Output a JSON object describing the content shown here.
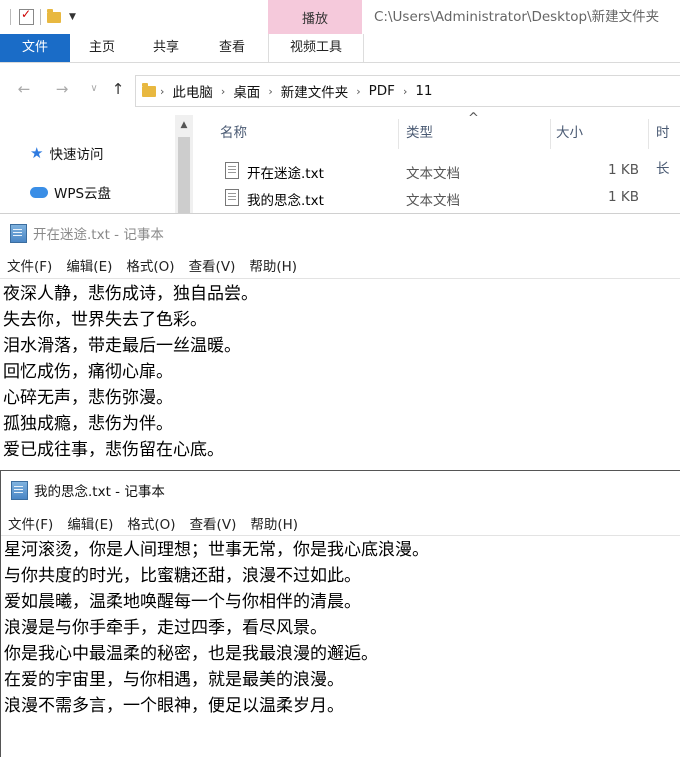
{
  "explorer": {
    "path_title": "C:\\Users\\Administrator\\Desktop\\新建文件夹",
    "contextual_tab": "播放",
    "ribbon_tabs": [
      "文件",
      "主页",
      "共享",
      "查看",
      "视频工具"
    ],
    "breadcrumbs": [
      "此电脑",
      "桌面",
      "新建文件夹",
      "PDF",
      "11"
    ],
    "nav_items": [
      "快速访问",
      "WPS云盘"
    ],
    "columns": [
      "名称",
      "类型",
      "大小",
      "时长"
    ],
    "files": [
      {
        "name": "开在迷途.txt",
        "type": "文本文档",
        "size": "1 KB"
      },
      {
        "name": "我的思念.txt",
        "type": "文本文档",
        "size": "1 KB"
      }
    ]
  },
  "notepads": [
    {
      "title": "开在迷途.txt - 记事本",
      "menu": [
        "文件(F)",
        "编辑(E)",
        "格式(O)",
        "查看(V)",
        "帮助(H)"
      ],
      "lines": [
        "夜深人静，悲伤成诗，独自品尝。",
        "失去你，世界失去了色彩。",
        "泪水滑落，带走最后一丝温暖。",
        "回忆成伤，痛彻心扉。",
        "心碎无声，悲伤弥漫。",
        "孤独成瘾，悲伤为伴。",
        "爱已成往事，悲伤留在心底。"
      ]
    },
    {
      "title": "我的思念.txt - 记事本",
      "menu": [
        "文件(F)",
        "编辑(E)",
        "格式(O)",
        "查看(V)",
        "帮助(H)"
      ],
      "lines": [
        "星河滚烫，你是人间理想；世事无常，你是我心底浪漫。",
        "与你共度的时光，比蜜糖还甜，浪漫不过如此。",
        "爱如晨曦，温柔地唤醒每一个与你相伴的清晨。",
        "浪漫是与你手牵手，走过四季，看尽风景。",
        "你是我心中最温柔的秘密，也是我最浪漫的邂逅。",
        "在爱的宇宙里，与你相遇，就是最美的浪漫。",
        "浪漫不需多言，一个眼神，便足以温柔岁月。"
      ]
    }
  ]
}
